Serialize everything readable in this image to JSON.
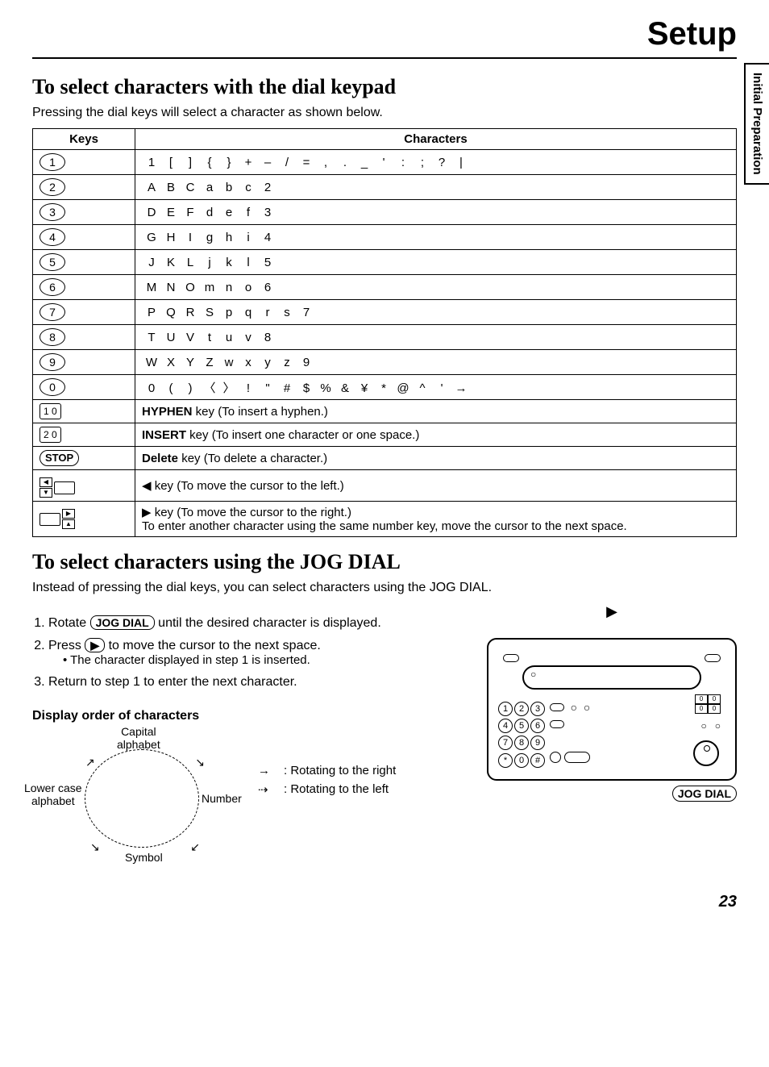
{
  "header": {
    "title": "Setup"
  },
  "side_tab": "Initial Preparation",
  "section1": {
    "heading": "To select characters with the dial keypad",
    "intro": "Pressing the dial keys will select a character as shown below.",
    "col_keys": "Keys",
    "col_chars": "Characters",
    "rows": [
      {
        "key": "1",
        "chars": [
          "1",
          "[",
          "]",
          "{",
          "}",
          "+",
          "–",
          "/",
          "=",
          ",",
          ".",
          "_",
          "'",
          ":",
          ";",
          "?",
          "|"
        ]
      },
      {
        "key": "2",
        "chars": [
          "A",
          "B",
          "C",
          "a",
          "b",
          "c",
          "2"
        ]
      },
      {
        "key": "3",
        "chars": [
          "D",
          "E",
          "F",
          "d",
          "e",
          "f",
          "3"
        ]
      },
      {
        "key": "4",
        "chars": [
          "G",
          "H",
          "I",
          "g",
          "h",
          "i",
          "4"
        ]
      },
      {
        "key": "5",
        "chars": [
          "J",
          "K",
          "L",
          "j",
          "k",
          "l",
          "5"
        ]
      },
      {
        "key": "6",
        "chars": [
          "M",
          "N",
          "O",
          "m",
          "n",
          "o",
          "6"
        ]
      },
      {
        "key": "7",
        "chars": [
          "P",
          "Q",
          "R",
          "S",
          "p",
          "q",
          "r",
          "s",
          "7"
        ]
      },
      {
        "key": "8",
        "chars": [
          "T",
          "U",
          "V",
          "t",
          "u",
          "v",
          "8"
        ]
      },
      {
        "key": "9",
        "chars": [
          "W",
          "X",
          "Y",
          "Z",
          "w",
          "x",
          "y",
          "z",
          "9"
        ]
      },
      {
        "key": "0",
        "chars": [
          "0",
          "(",
          ")",
          "〈",
          "〉",
          "!",
          "\"",
          "#",
          "$",
          "%",
          "&",
          "¥",
          "*",
          "@",
          "^",
          "'",
          "→"
        ]
      }
    ],
    "special_rows": [
      {
        "key_label": "1  0",
        "key_type": "rect",
        "desc_bold": "HYPHEN",
        "desc_rest": " key (To insert a hyphen.)"
      },
      {
        "key_label": "2  0",
        "key_type": "rect",
        "desc_bold": "INSERT",
        "desc_rest": " key (To insert one character or one space.)"
      },
      {
        "key_label": "STOP",
        "key_type": "stop",
        "desc_bold": "Delete",
        "desc_rest": " key (To delete a character.)"
      },
      {
        "key_label": "left-arrow",
        "key_type": "arrow-left",
        "desc_bold": "",
        "desc_rest": "◀ key (To move the cursor to the left.)"
      },
      {
        "key_label": "right-arrow",
        "key_type": "arrow-right",
        "desc_bold": "",
        "desc_rest": "▶ key (To move the cursor to the right.)\nTo enter another character using the same number key, move the cursor to the next space."
      }
    ]
  },
  "section2": {
    "heading": "To select characters using the JOG DIAL",
    "intro": "Instead of pressing the dial keys, you can select characters using the JOG DIAL.",
    "steps": [
      {
        "num": "1.",
        "pre": "Rotate ",
        "button": "JOG DIAL",
        "post": " until the desired character is displayed."
      },
      {
        "num": "2.",
        "pre": "Press ",
        "button": "▶",
        "post": " to move the cursor to the next space.",
        "sub": "• The character displayed in step 1 is inserted."
      },
      {
        "num": "3.",
        "pre": "",
        "button": "",
        "post": "Return to step 1 to enter the next character."
      }
    ],
    "jog_label": "JOG DIAL",
    "display_order_heading": "Display order of characters",
    "cycle": {
      "capital": "Capital\nalphabet",
      "number": "Number",
      "symbol": "Symbol",
      "lowercase": "Lower case\nalphabet"
    },
    "legend": {
      "right": ": Rotating to the right",
      "left": ": Rotating to the left"
    }
  },
  "page_number": "23"
}
